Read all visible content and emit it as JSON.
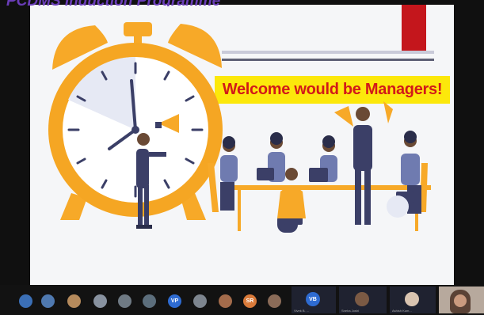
{
  "header": {
    "title": "PCDMS Induction Programme"
  },
  "slide": {
    "banner_text": "Welcome would be Managers!"
  },
  "participants": [
    {
      "initials": "",
      "color": "#3b6fb6",
      "icon": "avatar-icon"
    },
    {
      "initials": "",
      "color": "#4f79b0",
      "icon": "avatar-icon"
    },
    {
      "initials": "",
      "color": "#b58a5c",
      "icon": "avatar-icon"
    },
    {
      "initials": "",
      "color": "#8892a0",
      "icon": "avatar-icon"
    },
    {
      "initials": "",
      "color": "#6f7a84",
      "icon": "avatar-icon"
    },
    {
      "initials": "",
      "color": "#5c6e7c",
      "icon": "avatar-icon"
    },
    {
      "initials": "VP",
      "color": "#2e6bd1",
      "icon": "initials-avatar"
    },
    {
      "initials": "",
      "color": "#7d858f",
      "icon": "avatar-icon"
    },
    {
      "initials": "",
      "color": "#a36b4b",
      "icon": "avatar-icon"
    },
    {
      "initials": "SR",
      "color": "#d97a3a",
      "icon": "initials-avatar"
    },
    {
      "initials": "",
      "color": "#8a6b58",
      "icon": "avatar-icon"
    }
  ],
  "video_tiles": [
    {
      "initials": "VB",
      "label": "Vivek B. ..."
    },
    {
      "initials": "",
      "label": "Sneha Joshi"
    },
    {
      "initials": "",
      "label": "Ashish Kum..."
    },
    {
      "initials": "",
      "label": ""
    }
  ]
}
